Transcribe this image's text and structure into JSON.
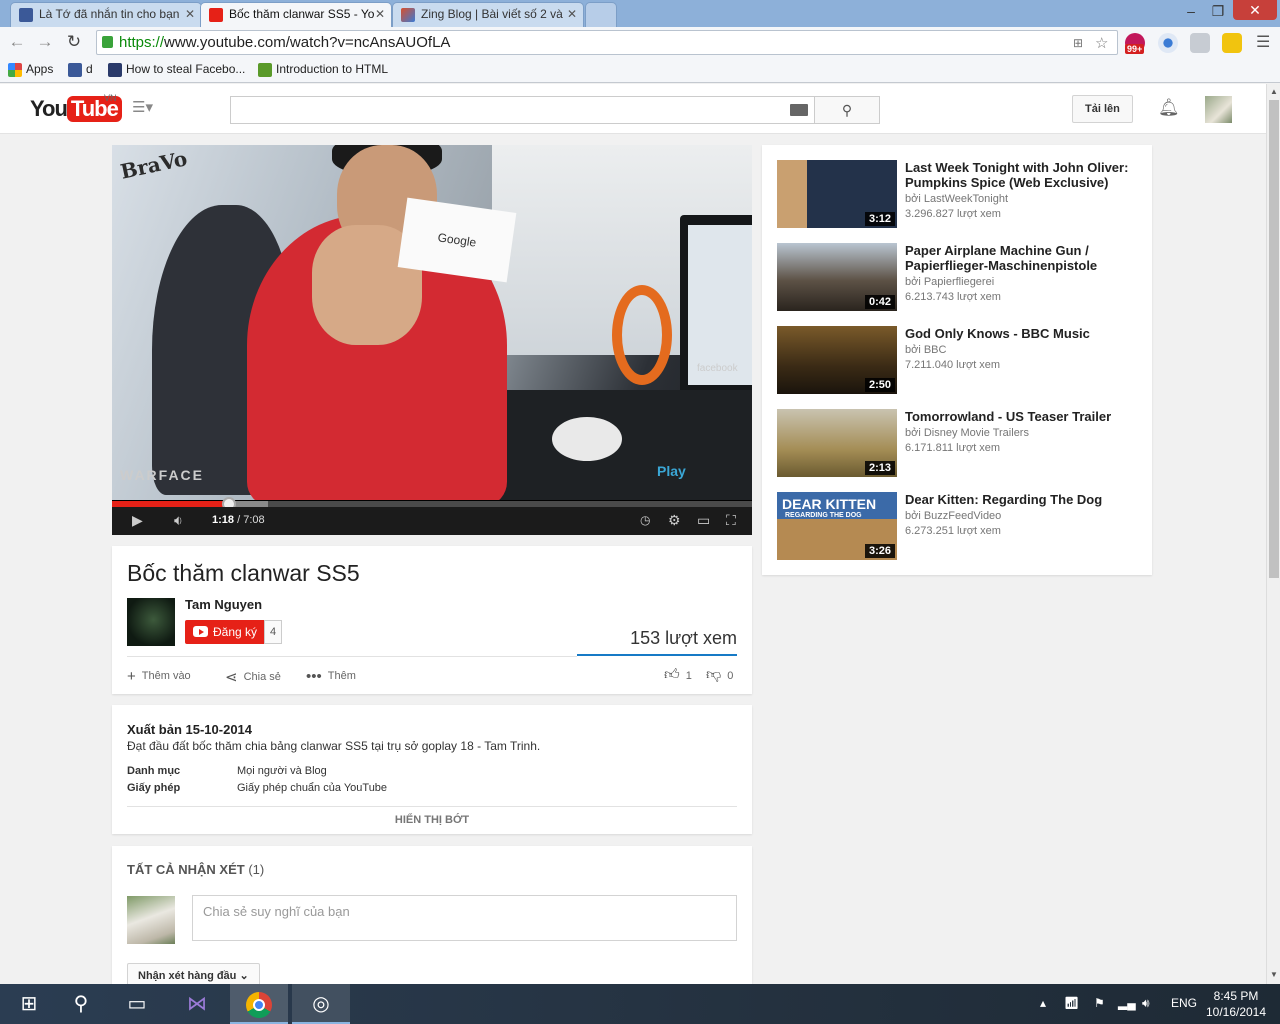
{
  "browser": {
    "tabs": [
      {
        "title": "Là Tớ đã nhắn tin cho bạn",
        "color": "#3b5998"
      },
      {
        "title": "Bốc thăm clanwar SS5 - Yo",
        "color": "#e62117"
      },
      {
        "title": "Zing Blog | Bài viết số 2 và",
        "color": "#d94f2b"
      }
    ],
    "url_scheme": "https://",
    "url_rest": "www.youtube.com/watch?v=ncAnsAUOfLA",
    "ext_badge": "99+",
    "bookmarks": [
      {
        "label": "Apps",
        "color": "#d44"
      },
      {
        "label": "d",
        "color": "#3b5998"
      },
      {
        "label": "How to steal Facebo...",
        "color": "#2a3a6a"
      },
      {
        "label": "Introduction to HTML",
        "color": "#5a9a2a"
      }
    ]
  },
  "youtube": {
    "logo_you": "You",
    "logo_tube": "Tube",
    "logo_region": "VN",
    "upload_label": "Tải lên"
  },
  "player": {
    "current_time": "1:18",
    "duration": "/ 7:08",
    "progress_fraction": 0.1822,
    "overlay_bravo": "BraVo",
    "overlay_warface": "WARFACE",
    "overlay_play": "Play",
    "card_text": "Google",
    "facebook_text": "facebook"
  },
  "video": {
    "title": "Bốc thăm clanwar SS5",
    "channel": "Tam Nguyen",
    "subscribe_label": "Đăng ký",
    "subscriber_count": "4",
    "views": "153 lượt xem",
    "actions": {
      "add": "Thêm vào",
      "share": "Chia sẻ",
      "more": "Thêm"
    },
    "likes": "1",
    "dislikes": "0"
  },
  "description": {
    "published": "Xuất bản 15-10-2014",
    "text": "Đạt đầu đất bốc thăm chia bảng clanwar SS5 tại trụ sở goplay 18 - Tam Trinh.",
    "category_label": "Danh mục",
    "category_value": "Mọi người và Blog",
    "license_label": "Giấy phép",
    "license_value": "Giấy phép chuẩn của YouTube",
    "show_less": "HIỂN THỊ BỚT"
  },
  "comments": {
    "title": "TẤT CẢ NHẬN XÉT",
    "count": "(1)",
    "placeholder": "Chia sẻ suy nghĩ của bạn",
    "sort_label": "Nhận xét hàng đầu"
  },
  "related": [
    {
      "title": "Last Week Tonight with John Oliver: Pumpkins Spice (Web Exclusive)",
      "by": "bởi LastWeekTonight",
      "views": "3.296.827 lượt xem",
      "duration": "3:12",
      "thumb": "#2a3140"
    },
    {
      "title": "Paper Airplane Machine Gun / Papierflieger-Maschinenpistole",
      "by": "bởi Papierfliegerei",
      "views": "6.213.743 lượt xem",
      "duration": "0:42",
      "thumb": "#6a5e50"
    },
    {
      "title": "God Only Knows - BBC Music",
      "by": "bởi BBC",
      "views": "7.211.040 lượt xem",
      "duration": "2:50",
      "thumb": "#4a3a22"
    },
    {
      "title": "Tomorrowland - US Teaser Trailer",
      "by": "bởi Disney Movie Trailers",
      "views": "6.171.811 lượt xem",
      "duration": "2:13",
      "thumb": "#a89a6a"
    },
    {
      "title": "Dear Kitten: Regarding The Dog",
      "by": "bởi BuzzFeedVideo",
      "views": "6.273.251 lượt xem",
      "duration": "3:26",
      "thumb": "#3b6aa8",
      "thumb_text": "DEAR KITTEN",
      "thumb_sub": "REGARDING THE DOG"
    }
  ],
  "taskbar": {
    "lang": "ENG",
    "time": "8:45 PM",
    "date": "10/16/2014"
  }
}
